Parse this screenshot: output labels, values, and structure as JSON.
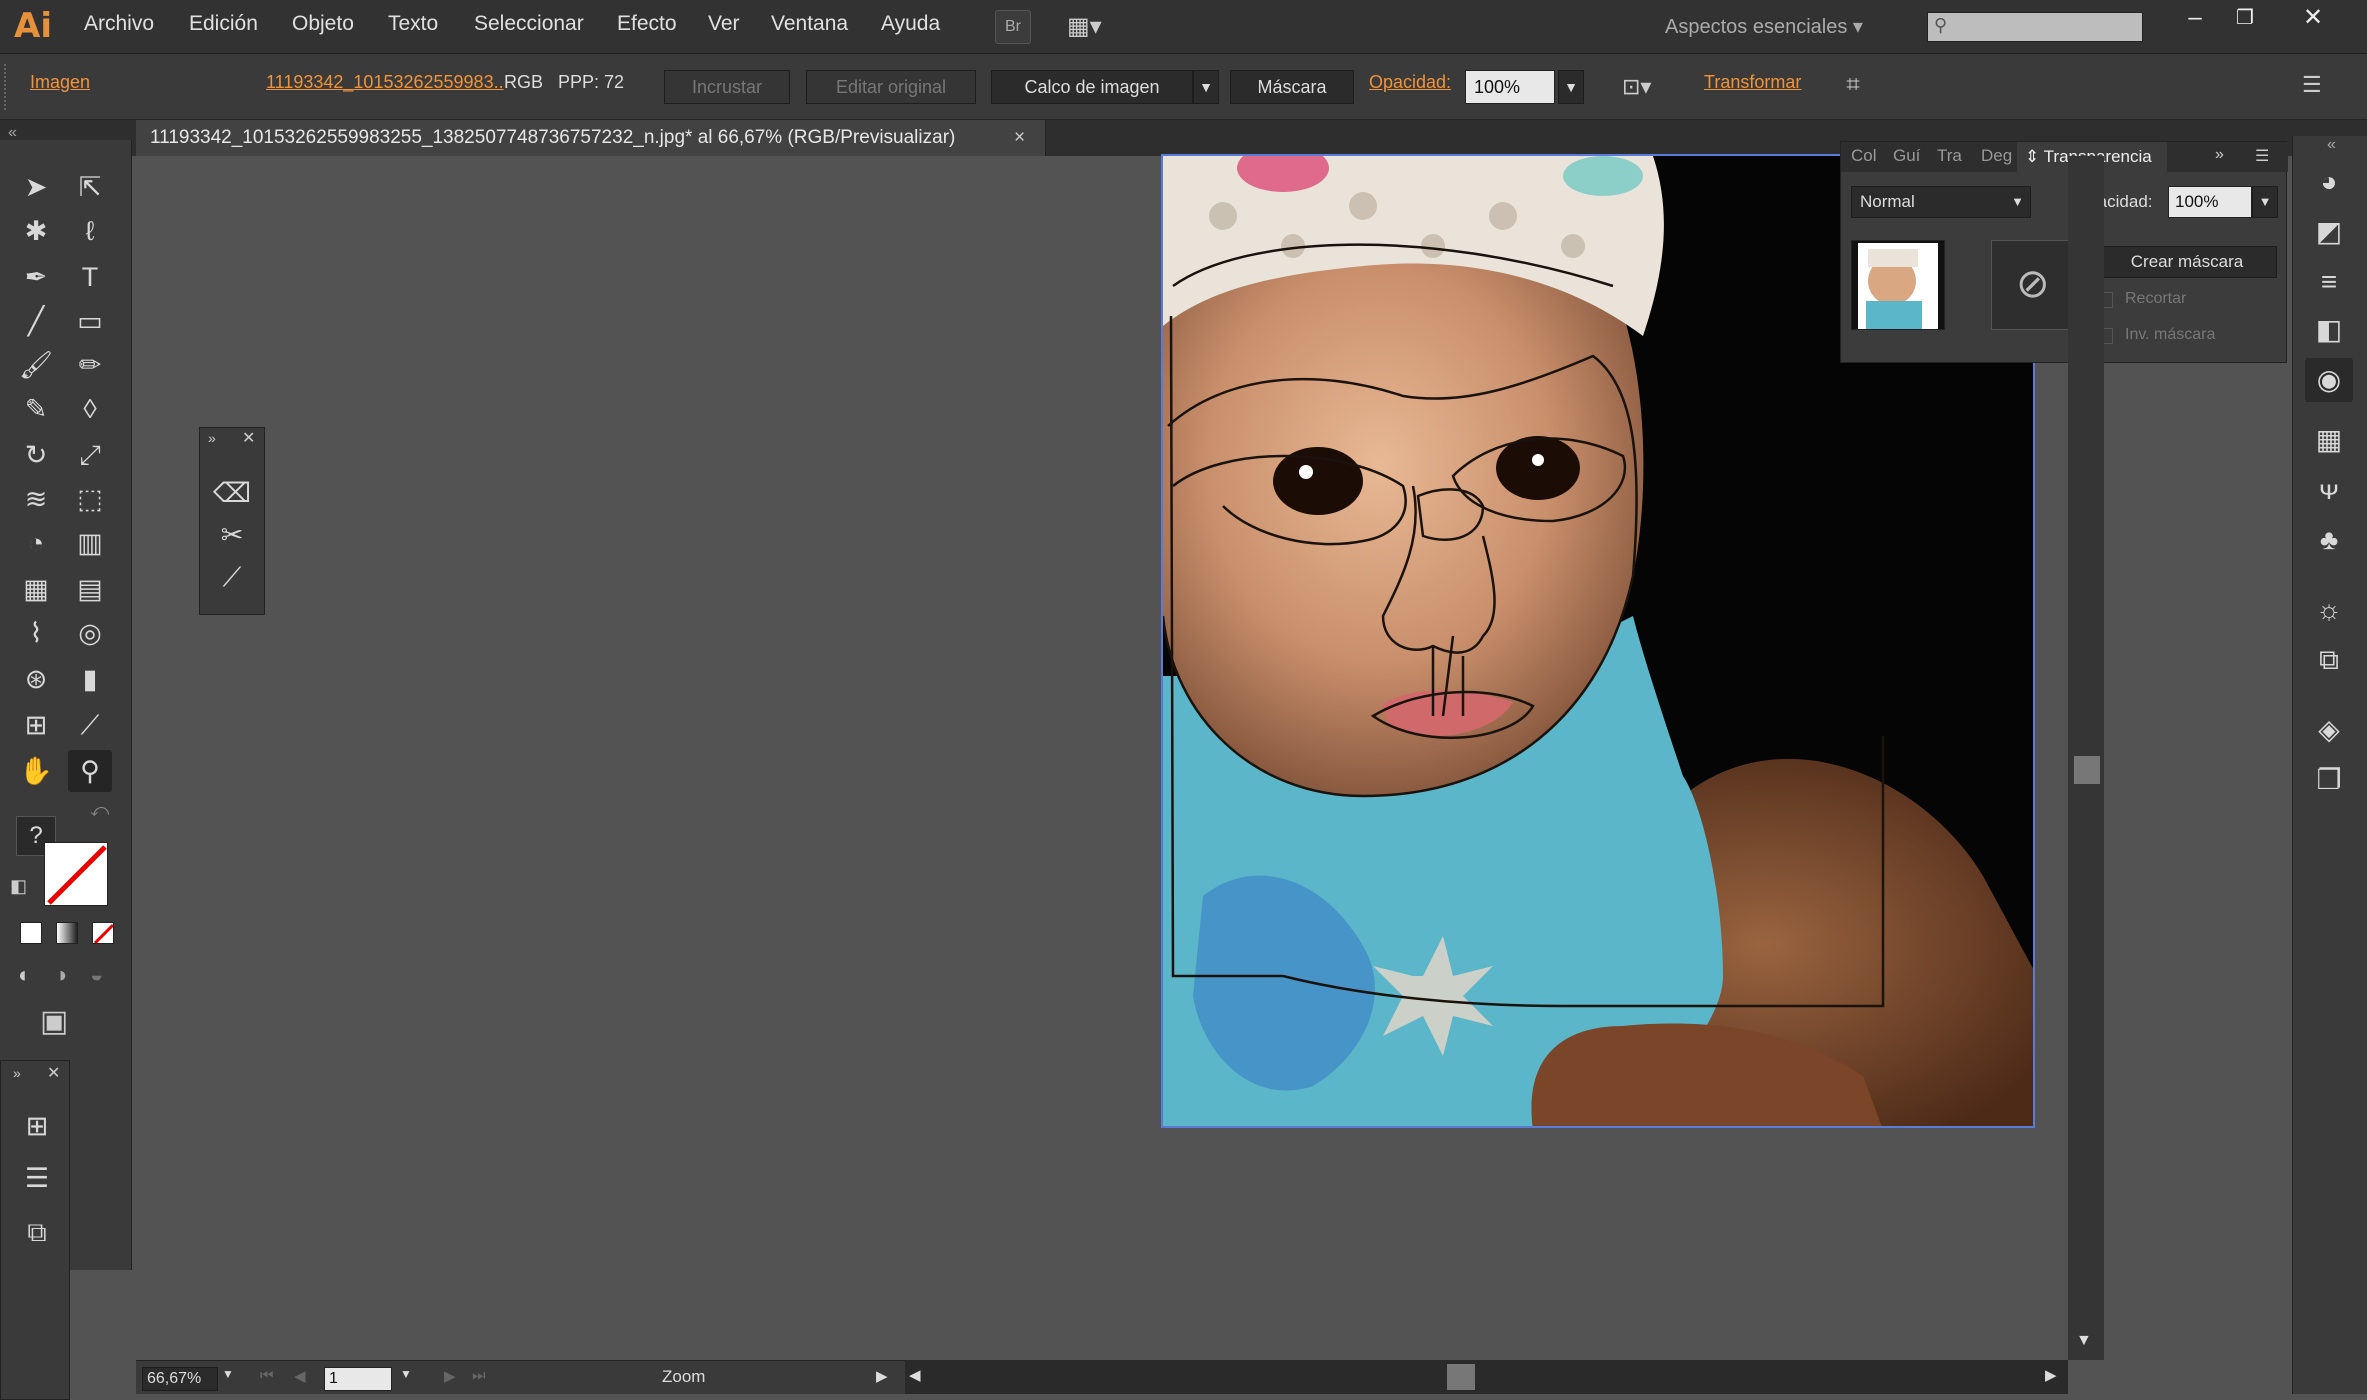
{
  "app": {
    "logo": "Ai"
  },
  "menu": [
    "Archivo",
    "Edición",
    "Objeto",
    "Texto",
    "Seleccionar",
    "Efecto",
    "Ver",
    "Ventana",
    "Ayuda"
  ],
  "menubar": {
    "bridge": "Br",
    "workspace": "Aspectos esenciales"
  },
  "control": {
    "object_type": "Imagen",
    "filename": "11193342_10153262559983..",
    "color_mode": "RGB",
    "ppi": "PPP: 72",
    "embed": "Incrustar",
    "edit_original": "Editar original",
    "trace": "Calco de imagen",
    "mask": "Máscara",
    "opacity_label": "Opacidad:",
    "opacity_value": "100%",
    "transform": "Transformar"
  },
  "document": {
    "tab_title": "11193342_10153262559983255_1382507748736757232_n.jpg* al 66,67% (RGB/Previsualizar)",
    "close": "×"
  },
  "transparency": {
    "tabs": [
      "Col",
      "Guí",
      "Tra",
      "Deg"
    ],
    "active_tab": "Transparencia",
    "blend_mode": "Normal",
    "opacity_label": "Opacidad:",
    "opacity_value": "100%",
    "make_mask": "Crear máscara",
    "clip": "Recortar",
    "invert": "Inv. máscara"
  },
  "toolbox": {
    "help": "?"
  },
  "status": {
    "zoom": "66,67%",
    "artboard": "1",
    "tool": "Zoom"
  },
  "colors": {
    "accent": "#f0933a",
    "selection": "#5b7bd8"
  }
}
